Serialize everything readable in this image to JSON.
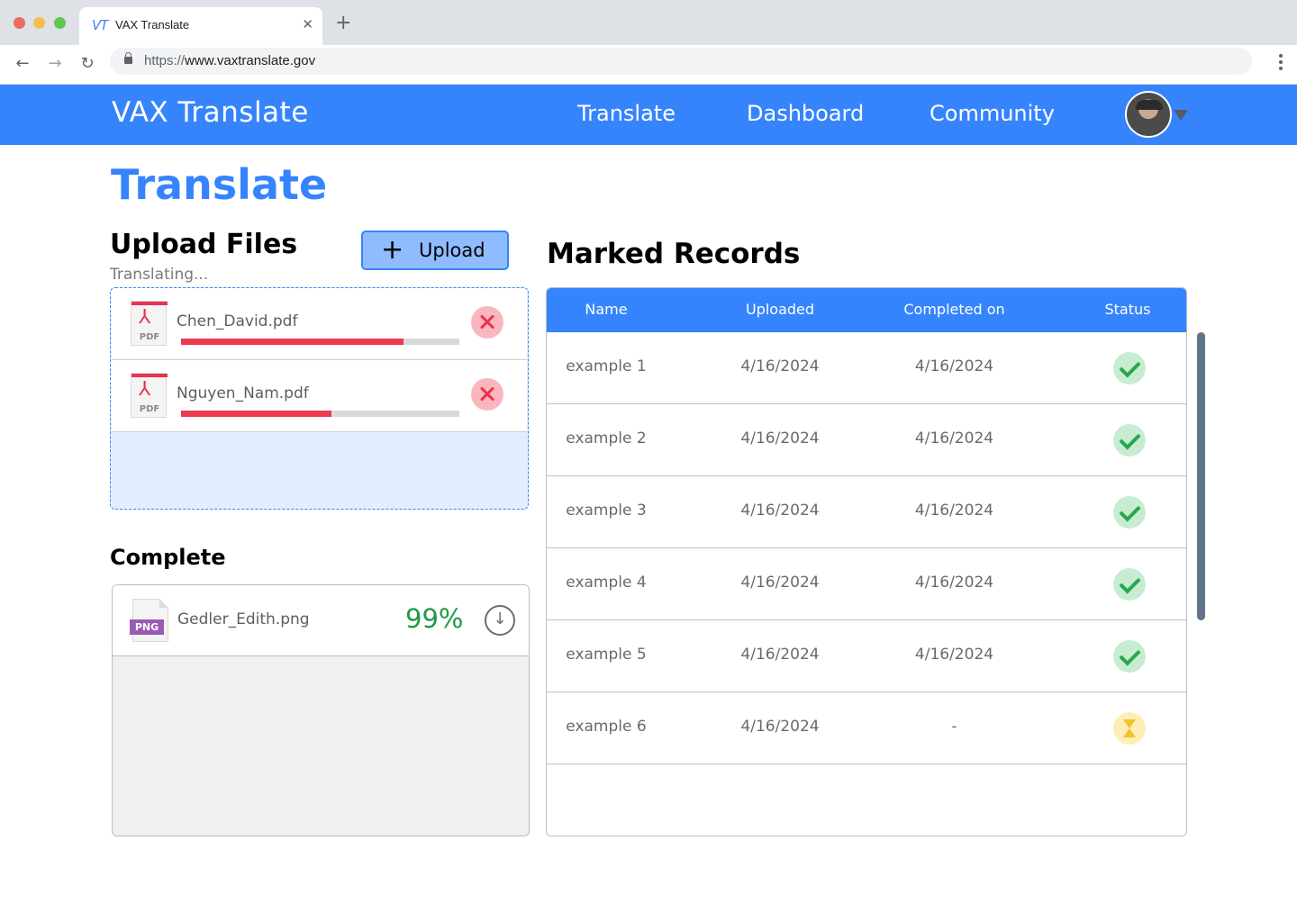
{
  "browser": {
    "tab_icon": "VT",
    "tab_title": "VAX Translate",
    "new_tab": "+",
    "url_proto": "https://",
    "url_host": "www.vaxtranslate.gov"
  },
  "header": {
    "brand": "VAX Translate",
    "nav": [
      "Translate",
      "Dashboard",
      "Community"
    ]
  },
  "page": {
    "title": "Translate"
  },
  "upload": {
    "heading": "Upload Files",
    "status": "Translating...",
    "button_label": "Upload",
    "files": [
      {
        "name": "Chen_David.pdf",
        "type": "PDF",
        "progress": 0.8
      },
      {
        "name": "Nguyen_Nam.pdf",
        "type": "PDF",
        "progress": 0.54
      }
    ]
  },
  "complete": {
    "heading": "Complete",
    "files": [
      {
        "name": "Gedler_Edith.png",
        "type": "PNG",
        "percent": "99%"
      }
    ]
  },
  "records": {
    "heading": "Marked Records",
    "columns": [
      "Name",
      "Uploaded",
      "Completed on",
      "Status"
    ],
    "rows": [
      {
        "name": "example 1",
        "uploaded": "4/16/2024",
        "completed": "4/16/2024",
        "status": "complete"
      },
      {
        "name": "example 2",
        "uploaded": "4/16/2024",
        "completed": "4/16/2024",
        "status": "complete"
      },
      {
        "name": "example 3",
        "uploaded": "4/16/2024",
        "completed": "4/16/2024",
        "status": "complete"
      },
      {
        "name": "example 4",
        "uploaded": "4/16/2024",
        "completed": "4/16/2024",
        "status": "complete"
      },
      {
        "name": "example 5",
        "uploaded": "4/16/2024",
        "completed": "4/16/2024",
        "status": "complete"
      },
      {
        "name": "example 6",
        "uploaded": "4/16/2024",
        "completed": "-",
        "status": "pending"
      }
    ]
  },
  "colors": {
    "brand": "#3684fc",
    "progress": "#ee3a4e",
    "success": "#1f9a47"
  }
}
